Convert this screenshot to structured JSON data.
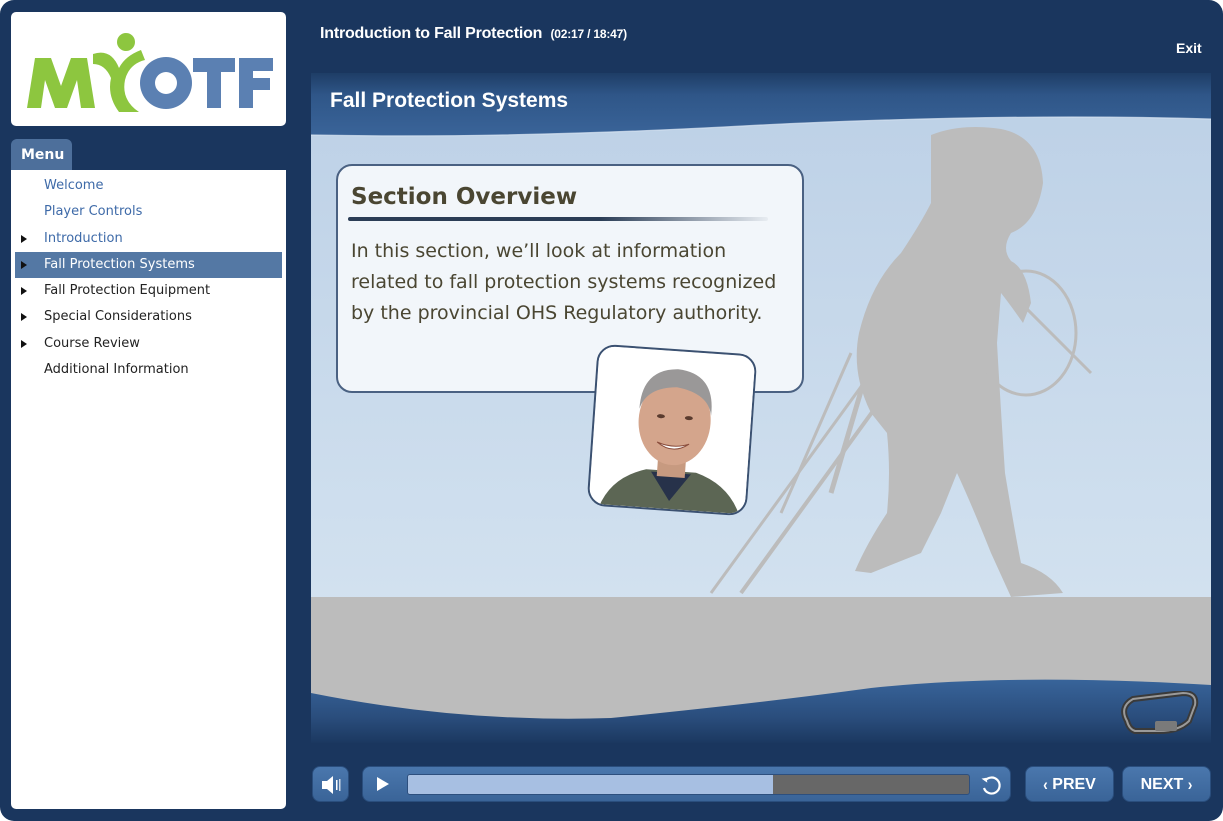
{
  "logo": {
    "text_left": "MY",
    "text_right": "OTF",
    "green": "#8dc63f",
    "blue": "#5b80b2"
  },
  "header": {
    "course_title": "Introduction to Fall Protection",
    "time_display": "(02:17 / 18:47)",
    "exit_label": "Exit"
  },
  "menu": {
    "tab_label": "Menu",
    "items": [
      {
        "label": "Welcome",
        "expandable": false,
        "style": "link"
      },
      {
        "label": "Player Controls",
        "expandable": false,
        "style": "link"
      },
      {
        "label": "Introduction",
        "expandable": true,
        "style": "link"
      },
      {
        "label": "Fall Protection Systems",
        "expandable": true,
        "style": "active"
      },
      {
        "label": "Fall Protection Equipment",
        "expandable": true,
        "style": "normal"
      },
      {
        "label": "Special Considerations",
        "expandable": true,
        "style": "normal"
      },
      {
        "label": "Course Review",
        "expandable": true,
        "style": "normal"
      },
      {
        "label": "Additional Information",
        "expandable": false,
        "style": "normal"
      }
    ]
  },
  "slide": {
    "title": "Fall Protection Systems",
    "overview_heading": "Section Overview",
    "overview_body": "In this section, we’ll look at information related to fall protection systems recognized by the provincial OHS Regulatory authority.",
    "images": [
      "presenter-photo",
      "worker-silhouette",
      "carabiner"
    ]
  },
  "controls": {
    "volume_icon": "speaker-icon",
    "play_icon": "play-icon",
    "replay_icon": "replay-icon",
    "progress_percent": 65,
    "prev_label": "PREV",
    "next_label": "NEXT",
    "prev_chevron": "‹",
    "next_chevron": "›"
  },
  "colors": {
    "frame": "#1a365e",
    "accent": "#3a6498",
    "active_menu": "#5478a4",
    "link": "#3e6aa8",
    "progress_fill": "#a7bfe2",
    "progress_track": "#676767"
  }
}
